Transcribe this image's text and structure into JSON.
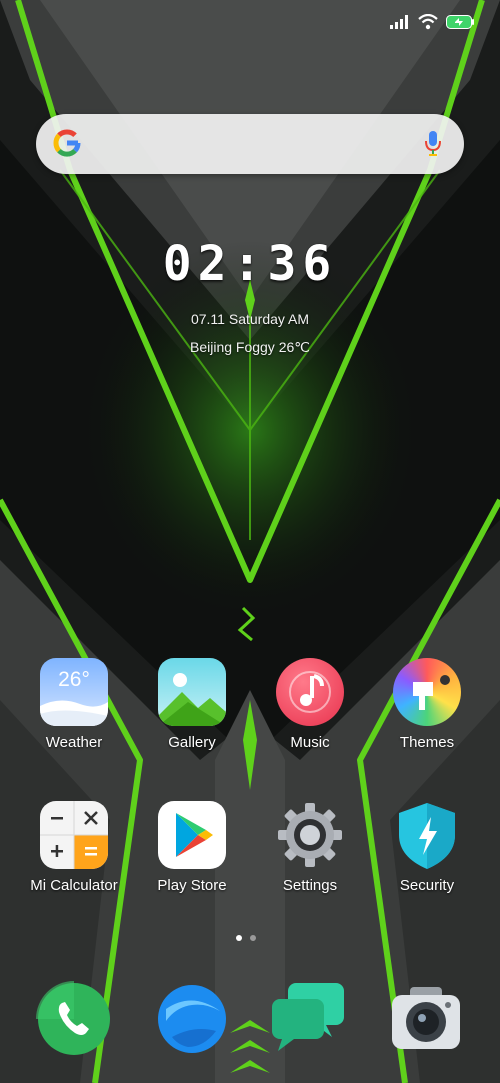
{
  "status_bar": {
    "icons": [
      "signal-icon",
      "wifi-icon",
      "battery-charging-icon"
    ]
  },
  "search_bar": {
    "logo": "google-g-icon",
    "mic": "microphone-icon"
  },
  "clock_widget": {
    "time": "02:36",
    "date": "07.11 Saturday AM",
    "weather": "Beijing  Foggy 26℃"
  },
  "apps": [
    {
      "label": "Weather",
      "icon": "weather-icon",
      "badge": "26°"
    },
    {
      "label": "Gallery",
      "icon": "gallery-icon"
    },
    {
      "label": "Music",
      "icon": "music-icon"
    },
    {
      "label": "Themes",
      "icon": "themes-icon"
    },
    {
      "label": "Mi Calculator",
      "icon": "calculator-icon"
    },
    {
      "label": "Play Store",
      "icon": "play-store-icon"
    },
    {
      "label": "Settings",
      "icon": "settings-icon"
    },
    {
      "label": "Security",
      "icon": "security-icon"
    }
  ],
  "page_indicator": {
    "pages": 2,
    "current": 1
  },
  "dock": [
    {
      "icon": "phone-icon"
    },
    {
      "icon": "browser-icon"
    },
    {
      "icon": "messages-icon"
    },
    {
      "icon": "camera-icon"
    }
  ],
  "colors": {
    "accent_green": "#5fd11b",
    "background": "#1d1f1e"
  }
}
